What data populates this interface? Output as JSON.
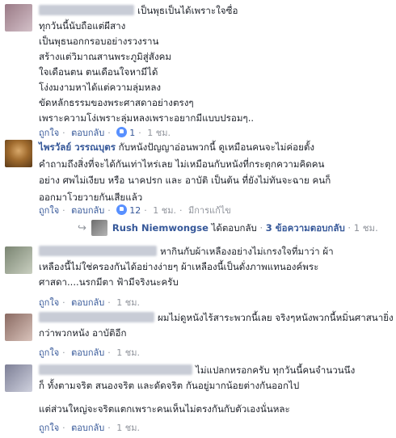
{
  "actions": {
    "like": "ถูกใจ",
    "reply": "ตอบกลับ",
    "edited": "มีการแก้ไข"
  },
  "comments": [
    {
      "text": [
        "เป็นพุธเป็นได้เพราะใจซื่อ",
        "ทุกวันนี้นับถือแต่ผีสาง",
        "เป็นพุธนอกกรอบอย่างรวงราน",
        "สร้างแต่วิมาณสานพระภูมิสู่สังคม",
        "ใจเดือนตน ตนเดือนใจหามีได้",
        "โง่งมงามหาได้แต่ความลุ่มหลง",
        "ขัดหลักธรรมของพระศาสดาอย่างตรงๆ",
        "เพราะความโง่เพราะลุ่มหลงเพราะอยากมีแบบปรอมๆ.."
      ],
      "likes": "1",
      "time": "1 ชม."
    },
    {
      "name": "ไพรวัลย์ วรรณบุตร",
      "text": [
        "กับหนังปัญญาอ่อนพวกนี้ ดูเหมือนคนจะไม่ค่อยตั้ง",
        "คำถามถึงสิ่งที่จะได้กันเท่าไหร่เลย ไม่เหมือนกับหนังที่กระตุกความคิดคน",
        "อย่าง ศพไม่เงียบ หรือ นาคปรก และ อาบัติ เป็นต้น ที่ยังไม่ทันจะฉาย คนก็",
        "ออกมาโวยวายกันเสียแล้ว"
      ],
      "likes": "12",
      "time": "1 ชม."
    },
    {
      "text": [
        "หากินกับผ้าเหลืองอย่างไม่เกรงใจที่มาว่า ผ้า",
        "เหลืองนี้ไม่ใช่ครองกันได้อย่างง่ายๆ ผ้าเหลืองนี้เป็นดั่งภาพแทนองค์พระ",
        "ศาสดา....นรกมีตา ฟ้ามีจริงนะครับ"
      ],
      "time": "1 ชม."
    },
    {
      "text": [
        "ผมไม่ดูหนังไร้สาระพวกนี้เลย จริงๆหนังพวกนี้หมิ่นศาสนายิ่ง",
        "กว่าพวกหนัง อาบัติอีก"
      ],
      "time": "1 ชม."
    },
    {
      "text": [
        "ไม่แปลกหรอกครับ ทุกวันนี้คนจำนวนนึง",
        "ก็ ทั้งตามจริต สนองจริต และดัดจริต กันอยู่มากน้อยต่างกันออกไป",
        "",
        "แต่ส่วนใหญ่จะจริตแตกเพราะคนเห็นไม่ตรงกันกับตัวเองนั่นหละ"
      ],
      "time": "1 ชม."
    }
  ],
  "reply": {
    "name": "Rush Niemwongse",
    "text": "ได้ตอบกลับ",
    "count": "3 ข้อความตอบกลับ",
    "time": "1 ชม."
  }
}
